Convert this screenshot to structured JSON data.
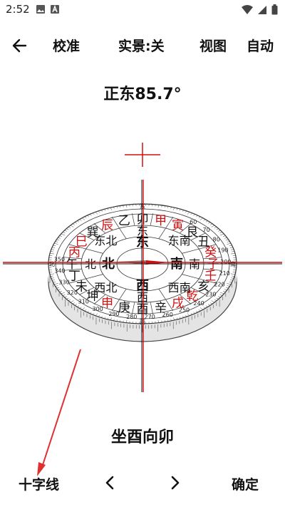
{
  "status": {
    "time": "2:52"
  },
  "toolbar": {
    "calibrate": "校准",
    "live_view": "实景:关",
    "view": "视图",
    "auto": "自动"
  },
  "heading": {
    "direction": "正东85.7°"
  },
  "result": {
    "text": "坐酉向卯"
  },
  "bottom": {
    "crosshair": "十字线",
    "confirm": "确定"
  },
  "compass": {
    "accent_color": "#d01010",
    "heading_degrees": 85.7,
    "inner_labels": [
      "北",
      "东",
      "南",
      "西"
    ],
    "mountains": [
      "酉",
      "庚",
      "申",
      "坤",
      "未",
      "丁",
      "午",
      "丙",
      "巳",
      "巽",
      "辰",
      "乙",
      "卯",
      "甲",
      "寅",
      "艮",
      "丑",
      "癸",
      "子",
      "壬",
      "亥",
      "乾",
      "戌",
      "辛"
    ],
    "degree_labels": [
      "350",
      "340",
      "330",
      "320",
      "310",
      "300",
      "290",
      "280",
      "270",
      "260",
      "250",
      "240",
      "230",
      "220",
      "210",
      "200",
      "190",
      "80",
      "70",
      "60"
    ],
    "ring_labels": [
      "北",
      "西",
      "南",
      "东"
    ]
  }
}
